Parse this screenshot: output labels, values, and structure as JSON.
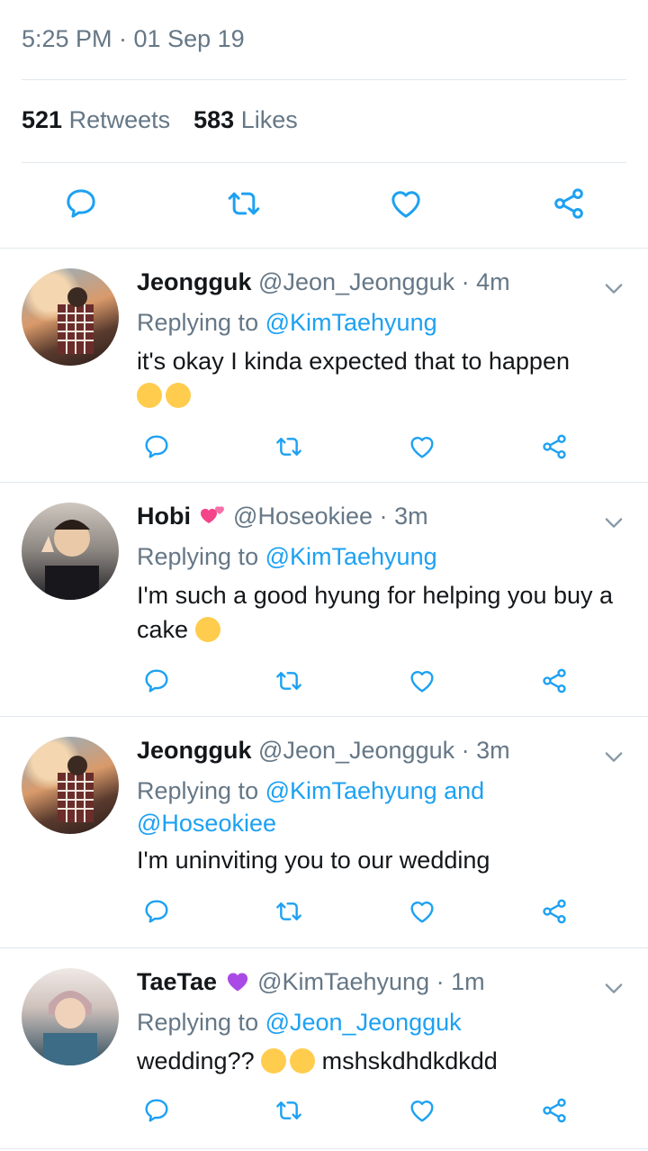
{
  "header": {
    "timestamp": "5:25 PM · 01 Sep 19",
    "retweets_count": "521",
    "retweets_label": "Retweets",
    "likes_count": "583",
    "likes_label": "Likes"
  },
  "colors": {
    "link": "#1da1f2",
    "secondary_text": "#657786",
    "primary_text": "#14171a",
    "divider": "#e1e8ed",
    "icon": "#1da1f2"
  },
  "tweets": [
    {
      "name": "Jeongguk",
      "handle": "@Jeon_Jeongguk",
      "time": "4m",
      "replying_prefix": "Replying to ",
      "replying_to": "@KimTaehyung",
      "text": "it's okay I kinda expected that to happen",
      "emojis": [
        "face-with-tears-of-joy",
        "face-with-tears-of-joy"
      ]
    },
    {
      "name": "Hobi",
      "name_emoji": "two-hearts",
      "handle": "@Hoseokiee",
      "time": "3m",
      "replying_prefix": "Replying to ",
      "replying_to": "@KimTaehyung",
      "text": "I'm such a good hyung for helping you buy a cake",
      "emojis": [
        "face-blowing-a-kiss"
      ]
    },
    {
      "name": "Jeongguk",
      "handle": "@Jeon_Jeongguk",
      "time": "3m",
      "replying_prefix": "Replying to ",
      "replying_to": "@KimTaehyung and @Hoseokiee",
      "text": "I'm uninviting you to our wedding",
      "emojis": []
    },
    {
      "name": "TaeTae",
      "name_emoji": "purple-heart",
      "handle": "@KimTaehyung",
      "time": "1m",
      "replying_prefix": "Replying to ",
      "replying_to": "@Jeon_Jeongguk",
      "text_before": "wedding??",
      "text_after": "mshskdhdkdkdd",
      "emojis": [
        "upside-down-face",
        "upside-down-face"
      ]
    }
  ],
  "dot": "·"
}
